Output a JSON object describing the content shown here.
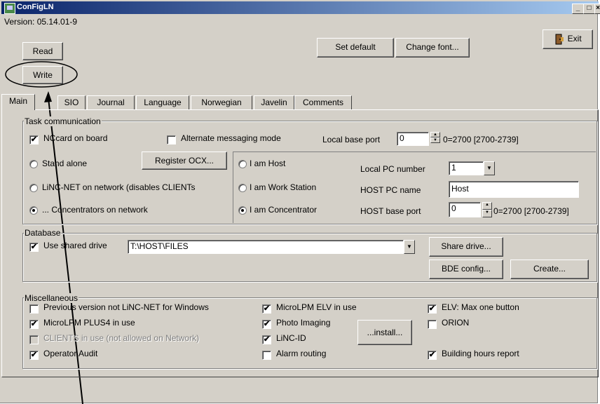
{
  "window": {
    "title": "ConFigLN",
    "minimize": "_",
    "maximize": "□",
    "close": "×"
  },
  "version_label": "Version: 05.14.01-9",
  "buttons": {
    "read": "Read",
    "write": "Write",
    "set_default": "Set default",
    "change_font": "Change font...",
    "exit": "Exit"
  },
  "tabs": [
    "Main",
    "SIO",
    "Journal",
    "Language",
    "Norwegian",
    "Javelin",
    "Comments"
  ],
  "active_tab": "Main",
  "task_communication": {
    "title": "Task communication",
    "nccard": {
      "label": "NCcard on board",
      "checked": true
    },
    "alt_messaging": {
      "label": "Alternate messaging mode",
      "checked": false
    },
    "local_base_port_label": "Local base port",
    "local_base_port_value": "0",
    "local_base_port_hint": "0=2700 [2700-2739]",
    "register_ocx": "Register OCX...",
    "mode_radios": [
      {
        "label": "Stand alone",
        "selected": false
      },
      {
        "label": "LiNC-NET on network (disables CLIENTs",
        "selected": false
      },
      {
        "label": "... Concentrators on network",
        "selected": true
      }
    ],
    "role_radios": [
      {
        "label": "I am Host",
        "selected": false
      },
      {
        "label": "I am Work Station",
        "selected": false
      },
      {
        "label": "I am Concentrator",
        "selected": true
      }
    ],
    "local_pc_number_label": "Local PC number",
    "local_pc_number_value": "1",
    "host_pc_name_label": "HOST PC name",
    "host_pc_name_value": "Host",
    "host_base_port_label": "HOST base port",
    "host_base_port_value": "0",
    "host_base_port_hint": "0=2700 [2700-2739]"
  },
  "database": {
    "title": "Database",
    "use_shared_drive": {
      "label": "Use shared drive",
      "checked": true
    },
    "path_value": "T:\\HOST\\FILES",
    "share_drive": "Share drive...",
    "bde_config": "BDE config...",
    "create": "Create..."
  },
  "miscellaneous": {
    "title": "Miscellaneous",
    "col1": [
      {
        "label": "Previous version not LiNC-NET for Windows",
        "checked": false,
        "disabled": false
      },
      {
        "label": "MicroLPM PLUS4 in use",
        "checked": true,
        "disabled": false
      },
      {
        "label": "CLIENTS in use (not allowed on Network)",
        "checked": false,
        "disabled": true
      },
      {
        "label": "Operator Audit",
        "checked": true,
        "disabled": false
      }
    ],
    "col2": [
      {
        "label": "MicroLPM ELV in use",
        "checked": true
      },
      {
        "label": "Photo Imaging",
        "checked": true
      },
      {
        "label": "LiNC-ID",
        "checked": true
      },
      {
        "label": "Alarm routing",
        "checked": false
      }
    ],
    "install": "...install...",
    "col3": [
      {
        "label": "ELV: Max one button",
        "checked": true
      },
      {
        "label": "ORION",
        "checked": false
      },
      {
        "label": "Building hours report",
        "checked": true
      }
    ]
  },
  "icons": {
    "app": "app-icon",
    "exit": "exit-door-icon",
    "check": "✔",
    "arrow_down": "▼",
    "arrow_up": "▲"
  }
}
